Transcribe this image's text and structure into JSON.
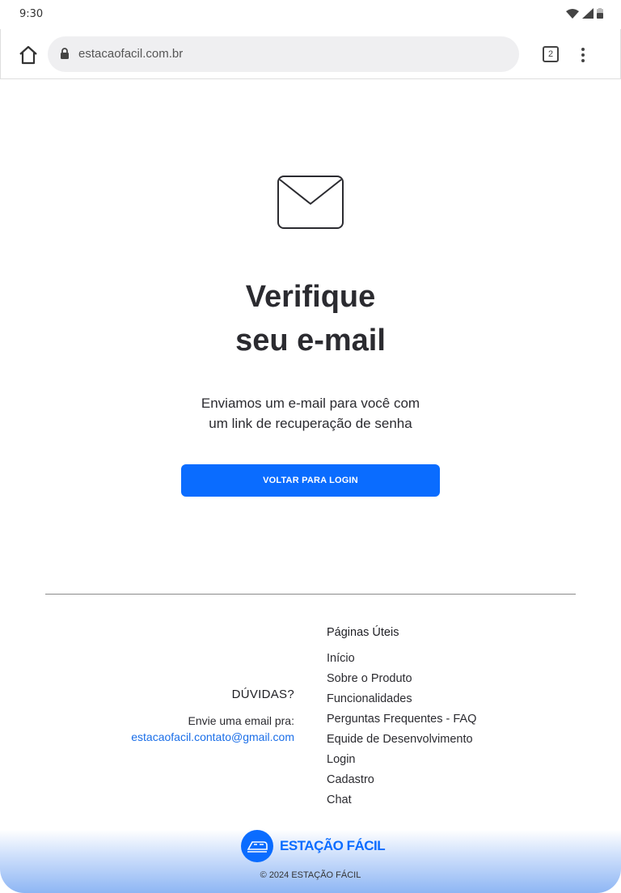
{
  "status_bar": {
    "time": "9:30"
  },
  "browser": {
    "url": "estacaofacil.com.br",
    "tab_count": "2"
  },
  "main": {
    "title_line1": "Verifique",
    "title_line2": "seu e-mail",
    "subtitle_line1": "Enviamos um e-mail para você com",
    "subtitle_line2": "um link de recuperação de senha",
    "button_label": "VOLTAR PARA LOGIN"
  },
  "footer": {
    "duvidas_title": "DÚVIDAS?",
    "duvidas_text": "Envie uma email pra:",
    "email": "estacaofacil.contato@gmail.com",
    "links_title": "Páginas Úteis",
    "links": [
      "Início",
      "Sobre o Produto",
      "Funcionalidades",
      "Perguntas Frequentes - FAQ",
      "Equide de Desenvolvimento",
      "Login",
      "Cadastro",
      "Chat"
    ],
    "brand": "ESTAÇÃO FÁCIL",
    "copyright": "© 2024 ESTAÇÃO FÁCIL"
  },
  "colors": {
    "accent": "#0a6cff",
    "link": "#1a6ee8",
    "text": "#2b2b30"
  }
}
